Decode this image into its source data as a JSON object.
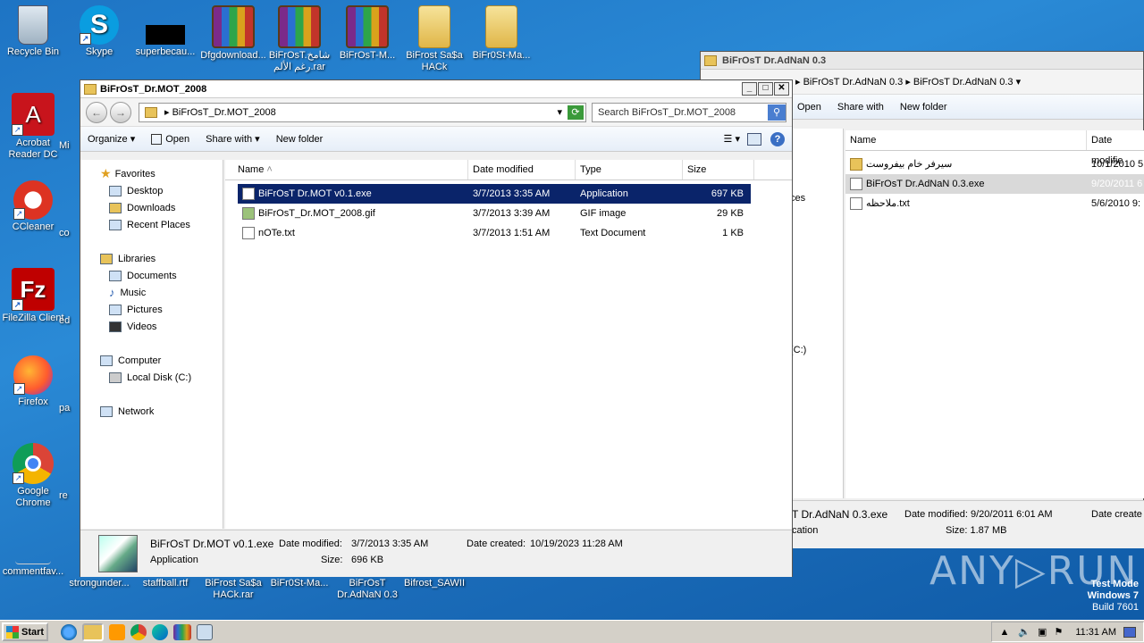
{
  "desktop": {
    "row1": [
      {
        "name": "recycle-bin-icon",
        "label": "Recycle Bin"
      },
      {
        "name": "skype-icon",
        "label": "Skype"
      },
      {
        "name": "superbecau-icon",
        "label": "superbecau..."
      },
      {
        "name": "dfgdownload-rar-icon",
        "label": "Dfgdownload..."
      },
      {
        "name": "bifrost-arabic-rar-icon",
        "label": "BiFrOsT.شامخ رغم الألم.rar"
      },
      {
        "name": "bifrost-m-rar-icon",
        "label": "BiFrOsT-M..."
      },
      {
        "name": "bifrost-saga-hack-icon",
        "label": "BiFrost Sa$a HACk"
      },
      {
        "name": "bifrost-ma-folder-icon",
        "label": "BiFr0St-Ma..."
      }
    ],
    "left_col": [
      {
        "name": "acrobat-reader-icon",
        "label": "Acrobat Reader DC"
      },
      {
        "name": "ccleaner-icon",
        "label": "CCleaner"
      },
      {
        "name": "filezilla-icon",
        "label": "FileZilla Client"
      },
      {
        "name": "firefox-icon",
        "label": "Firefox"
      },
      {
        "name": "chrome-icon",
        "label": "Google Chrome"
      },
      {
        "name": "commentfav-icon",
        "label": "commentfav..."
      }
    ],
    "partial_col2": [
      "Mi",
      "co",
      "ed",
      "pa",
      "re"
    ],
    "bottom_row": [
      {
        "name": "strongunder-icon",
        "label": "strongunder..."
      },
      {
        "name": "staffball-icon",
        "label": "staffball.rtf"
      },
      {
        "name": "bifrost-saga-rar-icon",
        "label": "BiFrost Sa$a HACk.rar"
      },
      {
        "name": "bifrost-ma2-icon",
        "label": "BiFr0St-Ma..."
      },
      {
        "name": "bifrost-adnan-icon",
        "label": "BiFrOsT Dr.AdNaN 0.3"
      },
      {
        "name": "bifrost-sawii-icon",
        "label": "Bifrost_SAWII"
      }
    ],
    "watermark": {
      "brand": "ANY",
      "brand2": "RUN",
      "line1": "Test Mode",
      "line2": "Windows 7",
      "line3": "Build 7601"
    }
  },
  "win_back": {
    "title": "BiFrOsT Dr.AdNaN 0.3",
    "breadcrumb": [
      "BiFrOsT Dr.AdNaN 0.3",
      "BiFrOsT Dr.AdNaN 0.3"
    ],
    "toolbar": {
      "open": "Open",
      "share": "Share with",
      "new_folder": "New folder"
    },
    "nav_partial": [
      "ces",
      "(C:)"
    ],
    "columns": {
      "name": "Name",
      "date": "Date modifie"
    },
    "rows": [
      {
        "name": "سيرفر خام بيفروست",
        "date": "10/1/2010 5"
      },
      {
        "name": "BiFrOsT Dr.AdNaN 0.3.exe",
        "date": "9/20/2011 6"
      },
      {
        "name": "ملاحظه.txt",
        "date": "5/6/2010 9:"
      }
    ],
    "details": {
      "name": "T Dr.AdNaN 0.3.exe",
      "modified": "Date modified: 9/20/2011 6:01 AM",
      "created": "Date create",
      "type": "cation",
      "size": "Size: 1.87 MB"
    }
  },
  "win_front": {
    "title": "BiFrOsT_Dr.MOT_2008",
    "breadcrumb": "BiFrOsT_Dr.MOT_2008",
    "search_placeholder": "Search BiFrOsT_Dr.MOT_2008",
    "toolbar": {
      "organize": "Organize",
      "open": "Open",
      "share": "Share with",
      "new_folder": "New folder"
    },
    "nav": {
      "favorites": "Favorites",
      "fav_items": [
        "Desktop",
        "Downloads",
        "Recent Places"
      ],
      "libraries": "Libraries",
      "lib_items": [
        "Documents",
        "Music",
        "Pictures",
        "Videos"
      ],
      "computer": "Computer",
      "comp_items": [
        "Local Disk (C:)"
      ],
      "network": "Network"
    },
    "columns": {
      "name": "Name",
      "date": "Date modified",
      "type": "Type",
      "size": "Size"
    },
    "rows": [
      {
        "name": "BiFrOsT Dr.MOT v0.1.exe",
        "date": "3/7/2013 3:35 AM",
        "type": "Application",
        "size": "697 KB"
      },
      {
        "name": "BiFrOsT_Dr.MOT_2008.gif",
        "date": "3/7/2013 3:39 AM",
        "type": "GIF image",
        "size": "29 KB"
      },
      {
        "name": "nOTe.txt",
        "date": "3/7/2013 1:51 AM",
        "type": "Text Document",
        "size": "1 KB"
      }
    ],
    "details": {
      "name": "BiFrOsT Dr.MOT v0.1.exe",
      "modified_label": "Date modified:",
      "modified": "3/7/2013 3:35 AM",
      "created_label": "Date created:",
      "created": "10/19/2023 11:28 AM",
      "type": "Application",
      "size_label": "Size:",
      "size": "696 KB"
    }
  },
  "taskbar": {
    "start": "Start",
    "clock": "11:31 AM"
  }
}
